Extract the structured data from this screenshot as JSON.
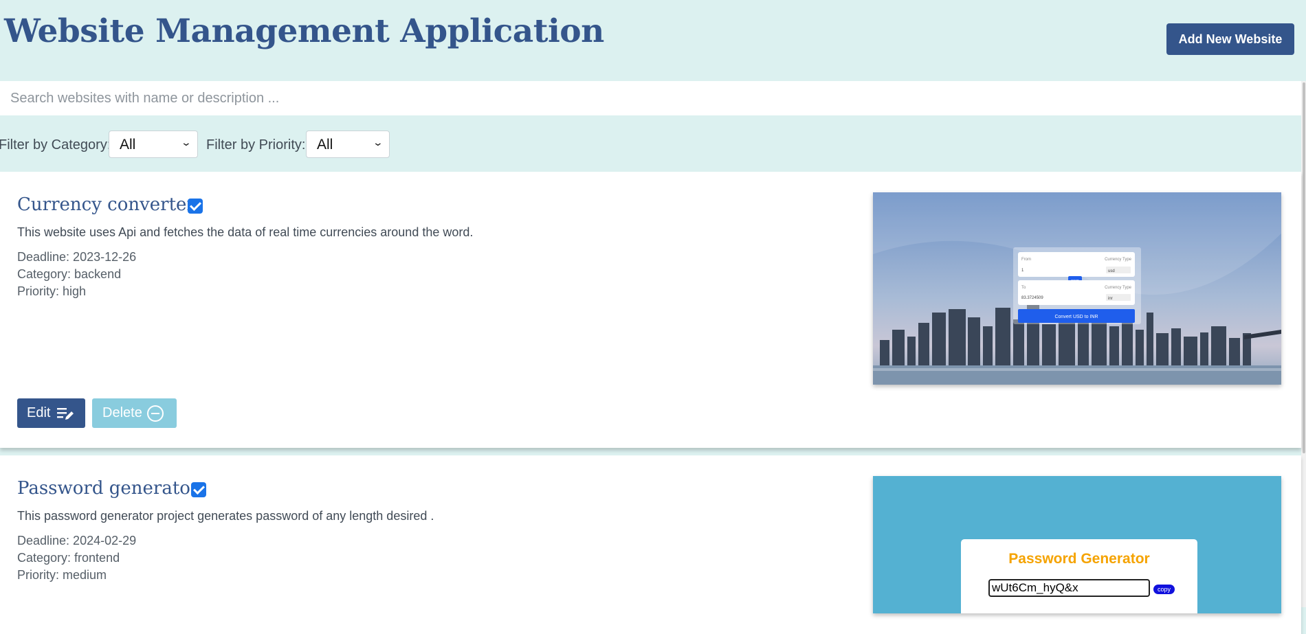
{
  "header": {
    "title": "Website Management Application",
    "add_button": "Add New Website"
  },
  "search": {
    "placeholder": "Search websites with name or description ...",
    "value": ""
  },
  "filters": {
    "category_label": "Filter by Category:",
    "category_value": "All",
    "priority_label": "Filter by Priority:",
    "priority_value": "All"
  },
  "buttons": {
    "edit": "Edit",
    "delete": "Delete"
  },
  "websites": [
    {
      "title": "Currency converter",
      "checked": true,
      "description": "This website uses Api and fetches the data of real time currencies around the word.",
      "deadline": "Deadline: 2023-12-26",
      "category": "Category: backend",
      "priority": "Priority: high",
      "preview": {
        "from_label": "From",
        "type_label": "Currency Type",
        "from_value": "1",
        "from_currency": "usd",
        "swap_label": "swap",
        "to_label": "To",
        "to_value": "83.3724509",
        "to_currency": "inr",
        "convert_button": "Convert USD to INR"
      }
    },
    {
      "title": "Password generator",
      "checked": true,
      "description": "This password generator project generates password of any length desired .",
      "deadline": "Deadline: 2024-02-29",
      "category": "Category: frontend",
      "priority": "Priority: medium",
      "preview": {
        "heading": "Password Generator",
        "password": "wUt6Cm_hyQ&x",
        "copy_button": "copy"
      }
    }
  ],
  "colors": {
    "page_bg": "#dcf1f0",
    "primary": "#34558b",
    "delete_button": "#89ccde",
    "checkbox": "#1a73e8",
    "password_preview_bg": "#54b1d2",
    "password_heading": "#f5a300"
  },
  "icons": {
    "edit_icon": "edit-icon",
    "delete_icon": "minus-circle-icon",
    "select_chevron": "chevron-down-icon",
    "checkbox": "checkmark-icon"
  }
}
